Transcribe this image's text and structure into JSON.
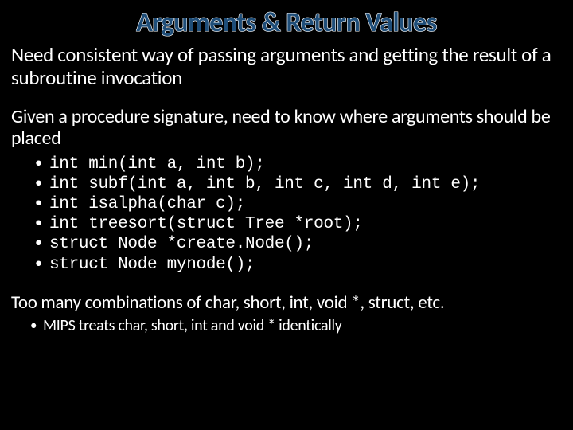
{
  "title": "Arguments & Return Values",
  "para1": "Need consistent way of passing arguments and getting the result of a subroutine invocation",
  "para2": "Given a procedure signature, need to know where arguments should be placed",
  "signatures": [
    "int min(int a, int b);",
    "int subf(int a, int b, int c, int d, int e);",
    "int isalpha(char c);",
    "int treesort(struct Tree *root);",
    "struct Node *create.Node();",
    "struct Node mynode();"
  ],
  "para3": "Too many combinations of char, short, int, void *, struct, etc.",
  "sublist": [
    "MIPS treats char, short, int and void * identically"
  ]
}
